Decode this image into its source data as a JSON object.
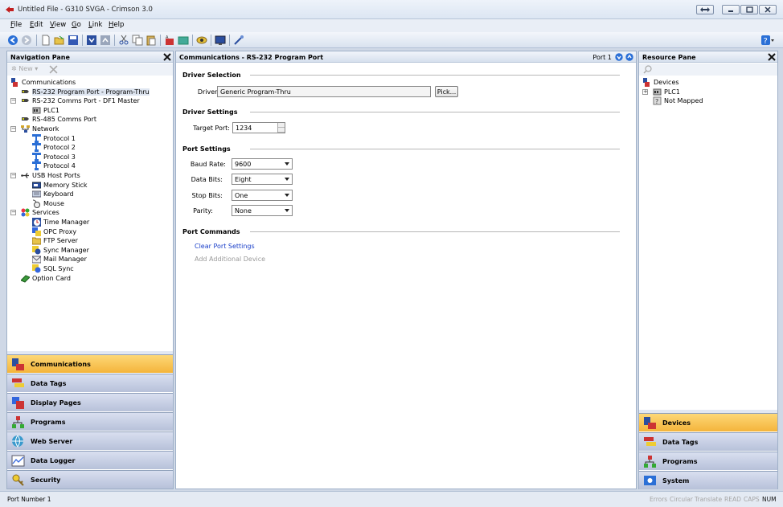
{
  "window": {
    "title": "Untitled File - G310 SVGA - Crimson 3.0"
  },
  "menu": [
    "File",
    "Edit",
    "View",
    "Go",
    "Link",
    "Help"
  ],
  "nav": {
    "header": "Navigation Pane",
    "new_label": "New",
    "tree": [
      {
        "label": "Communications",
        "icon": "communications-icon"
      },
      {
        "label": "RS-232 Program Port - Program-Thru",
        "icon": "serial-port-icon"
      },
      {
        "label": "RS-232 Comms Port - DF1 Master",
        "icon": "serial-port-icon"
      },
      {
        "label": "PLC1",
        "icon": "plc-icon"
      },
      {
        "label": "RS-485 Comms Port",
        "icon": "serial-port-icon"
      },
      {
        "label": "Network",
        "icon": "network-icon"
      },
      {
        "label": "Protocol 1",
        "icon": "protocol-icon"
      },
      {
        "label": "Protocol 2",
        "icon": "protocol-icon"
      },
      {
        "label": "Protocol 3",
        "icon": "protocol-icon"
      },
      {
        "label": "Protocol 4",
        "icon": "protocol-icon"
      },
      {
        "label": "USB Host Ports",
        "icon": "usb-icon"
      },
      {
        "label": "Memory Stick",
        "icon": "memory-stick-icon"
      },
      {
        "label": "Keyboard",
        "icon": "keyboard-icon"
      },
      {
        "label": "Mouse",
        "icon": "mouse-icon"
      },
      {
        "label": "Services",
        "icon": "services-icon"
      },
      {
        "label": "Time Manager",
        "icon": "clock-icon"
      },
      {
        "label": "OPC Proxy",
        "icon": "opc-icon"
      },
      {
        "label": "FTP Server",
        "icon": "folder-icon"
      },
      {
        "label": "Sync Manager",
        "icon": "sync-icon"
      },
      {
        "label": "Mail Manager",
        "icon": "mail-icon"
      },
      {
        "label": "SQL Sync",
        "icon": "sql-icon"
      },
      {
        "label": "Option Card",
        "icon": "option-card-icon"
      }
    ],
    "categories": [
      {
        "label": "Communications",
        "active": true
      },
      {
        "label": "Data Tags",
        "active": false
      },
      {
        "label": "Display Pages",
        "active": false
      },
      {
        "label": "Programs",
        "active": false
      },
      {
        "label": "Web Server",
        "active": false
      },
      {
        "label": "Data Logger",
        "active": false
      },
      {
        "label": "Security",
        "active": false
      }
    ]
  },
  "main": {
    "header": "Communications - RS-232 Program Port",
    "port_label": "Port 1",
    "driver_selection": {
      "title": "Driver Selection",
      "driver_label": "Driver:",
      "driver_value": "Generic Program-Thru",
      "pick_label": "Pick..."
    },
    "driver_settings": {
      "title": "Driver Settings",
      "target_port_label": "Target Port:",
      "target_port_value": "1234"
    },
    "port_settings": {
      "title": "Port Settings",
      "baud_label": "Baud Rate:",
      "baud_value": "9600",
      "data_bits_label": "Data Bits:",
      "data_bits_value": "Eight",
      "stop_bits_label": "Stop Bits:",
      "stop_bits_value": "One",
      "parity_label": "Parity:",
      "parity_value": "None"
    },
    "port_commands": {
      "title": "Port Commands",
      "clear_label": "Clear Port Settings",
      "add_label": "Add Additional Device"
    }
  },
  "resource": {
    "header": "Resource Pane",
    "tree": [
      {
        "label": "Devices",
        "icon": "devices-icon"
      },
      {
        "label": "PLC1",
        "icon": "plc-icon"
      },
      {
        "label": "Not Mapped",
        "icon": "not-mapped-icon"
      }
    ],
    "categories": [
      {
        "label": "Devices",
        "active": true
      },
      {
        "label": "Data Tags",
        "active": false
      },
      {
        "label": "Programs",
        "active": false
      },
      {
        "label": "System",
        "active": false
      }
    ]
  },
  "status": {
    "left": "Port Number 1",
    "errors": "Errors",
    "circular": "Circular",
    "translate": "Translate",
    "read": "READ",
    "caps": "CAPS",
    "num": "NUM"
  },
  "colors": {
    "active_category": "#f4b43b",
    "link": "#1a3fc9",
    "disabled_link": "#9a9a9a"
  }
}
